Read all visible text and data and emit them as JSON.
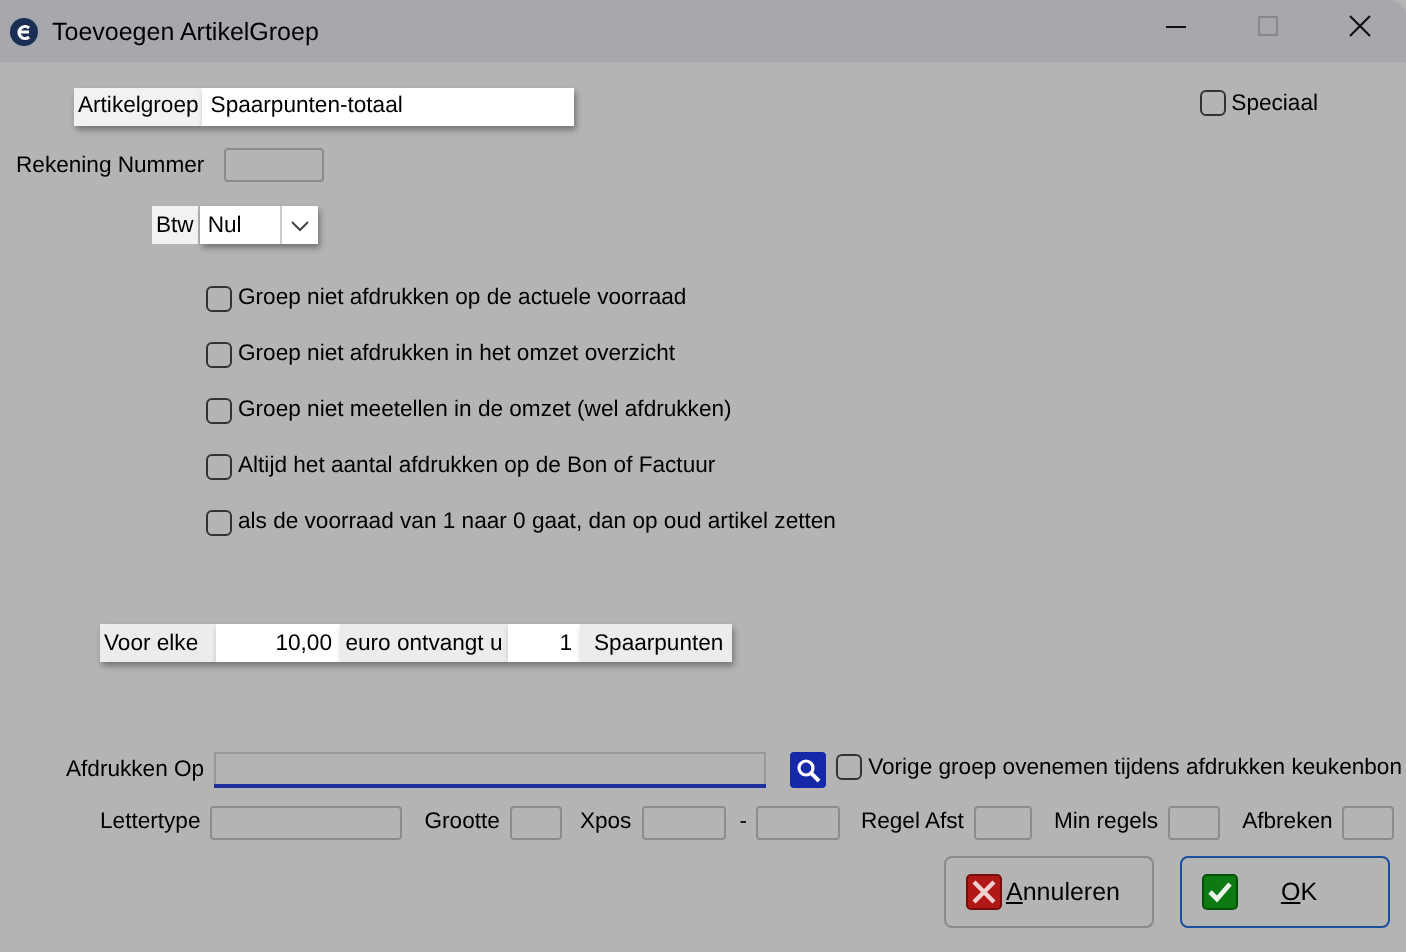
{
  "window": {
    "title": "Toevoegen ArtikelGroep"
  },
  "artikelgroep": {
    "label": "Artikelgroep",
    "value": "Spaarpunten-totaal"
  },
  "speciaal": {
    "label": "Speciaal",
    "checked": false
  },
  "rekening_nummer": {
    "label": "Rekening Nummer"
  },
  "btw": {
    "label": "Btw",
    "value": "Nul"
  },
  "options": [
    {
      "label": "Groep niet afdrukken op de actuele voorraad",
      "checked": false
    },
    {
      "label": "Groep niet afdrukken in het omzet overzicht",
      "checked": false
    },
    {
      "label": "Groep niet meetellen in de omzet (wel afdrukken)",
      "checked": false
    },
    {
      "label": "Altijd het aantal afdrukken op de Bon of Factuur",
      "checked": false
    },
    {
      "label": "als de voorraad van 1 naar 0 gaat, dan op oud artikel zetten",
      "checked": false
    }
  ],
  "spaarpunten": {
    "label_before": "Voor elke",
    "amount": "10,00",
    "label_middle": "euro ontvangt u",
    "points": "1",
    "label_after": "Spaarpunten"
  },
  "afdrukken_op": {
    "label": "Afdrukken Op"
  },
  "vorige_groep": {
    "label": "Vorige groep ovenemen tijdens afdrukken keukenbon",
    "checked": false
  },
  "print_fields": [
    {
      "label": "Lettertype"
    },
    {
      "label": "Grootte"
    },
    {
      "label": "Xpos"
    },
    {
      "label": "-"
    },
    {
      "label": "Regel Afst"
    },
    {
      "label": "Min regels"
    },
    {
      "label": "Afbreken"
    }
  ],
  "buttons": [
    {
      "kind": "cancel",
      "accel": "A",
      "rest": "nnuleren",
      "default": false
    },
    {
      "kind": "ok",
      "accel": "O",
      "rest": "K",
      "default": true
    }
  ]
}
